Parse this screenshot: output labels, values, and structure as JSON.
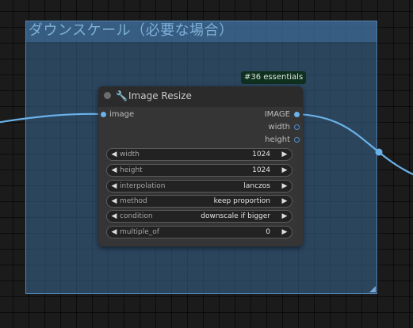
{
  "group": {
    "title": "ダウンスケール（必要な場合）",
    "color": "#3c70a0"
  },
  "badge": {
    "text": "#36 essentials"
  },
  "node": {
    "title": "Image Resize",
    "title_icon": "wrench-icon",
    "inputs": [
      {
        "label": "image"
      }
    ],
    "outputs": [
      {
        "label": "IMAGE"
      },
      {
        "label": "width"
      },
      {
        "label": "height"
      }
    ],
    "widgets": [
      {
        "label": "width",
        "value": "1024"
      },
      {
        "label": "height",
        "value": "1024"
      },
      {
        "label": "interpolation",
        "value": "lanczos"
      },
      {
        "label": "method",
        "value": "keep proportion"
      },
      {
        "label": "condition",
        "value": "downscale if bigger"
      },
      {
        "label": "multiple_of",
        "value": "0"
      }
    ]
  },
  "colors": {
    "link": "#6ab2ea",
    "canvas": "#1b1b1b",
    "node_body": "#353535",
    "node_title": "#2b2b2b"
  }
}
